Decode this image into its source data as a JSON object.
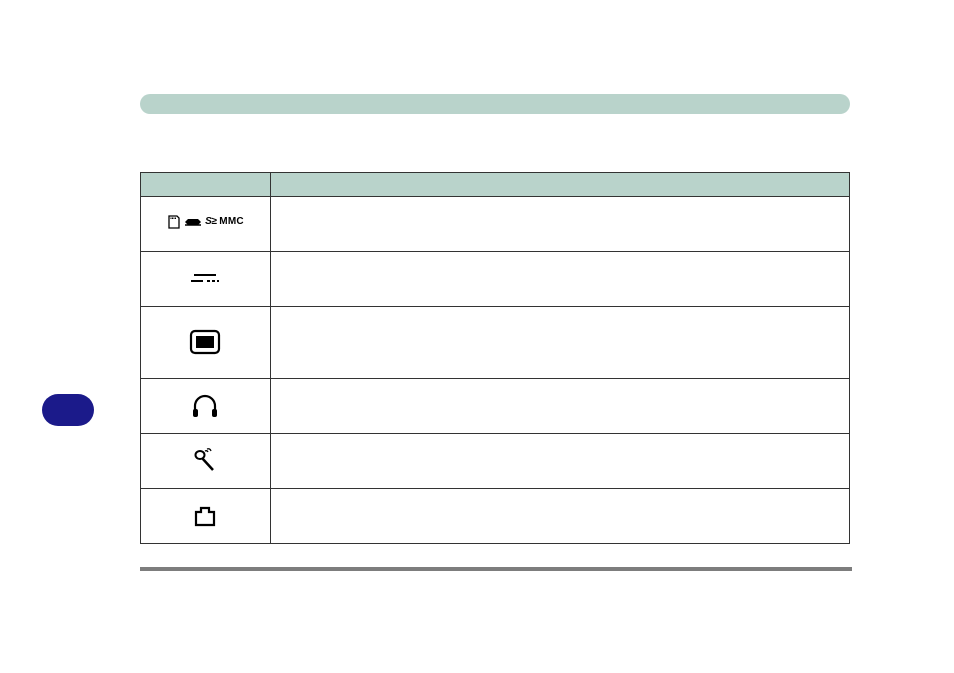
{
  "banner": {
    "color": "#b9d3cb"
  },
  "side_pill": {
    "color": "#1b1a8a"
  },
  "table": {
    "header": {
      "icon_col": "",
      "desc_col": ""
    },
    "rows": [
      {
        "icon_name": "card-slot-icons",
        "desc": ""
      },
      {
        "icon_name": "ieee1394-icon",
        "desc": ""
      },
      {
        "icon_name": "crt-monitor-icon",
        "desc": ""
      },
      {
        "icon_name": "headphones-icon",
        "desc": ""
      },
      {
        "icon_name": "microphone-icon",
        "desc": ""
      },
      {
        "icon_name": "modem-icon",
        "desc": ""
      }
    ]
  }
}
